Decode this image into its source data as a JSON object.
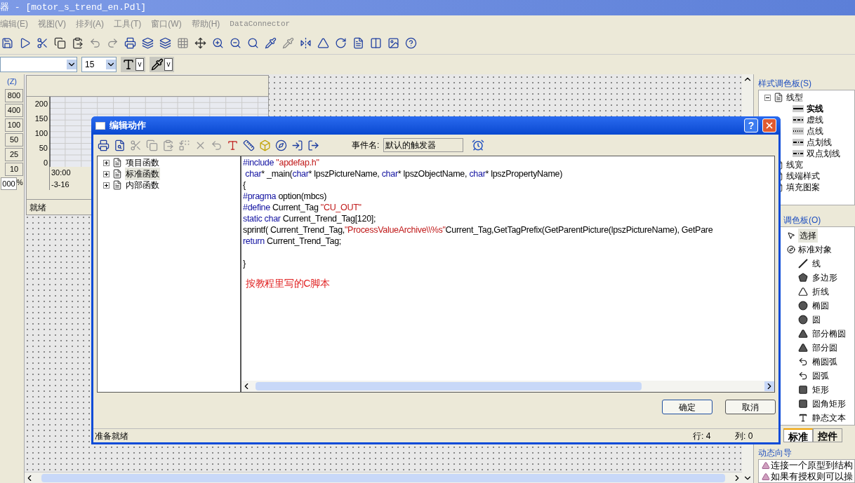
{
  "window": {
    "title": "器 - [motor_s_trend_en.Pdl]"
  },
  "menu": [
    "编辑(E)",
    "视图(V)",
    "排列(A)",
    "工具(T)",
    "窗口(W)",
    "帮助(H)",
    "DataConnector"
  ],
  "format_bar": {
    "font_size": "15",
    "carets": [
      "v",
      "v"
    ]
  },
  "zoom_panel": {
    "title": "(Z)",
    "buttons": [
      "800",
      "400",
      "100",
      "50",
      "25",
      "10"
    ],
    "field": "000",
    "unit": "%"
  },
  "trend_window": {
    "yticks": [
      "200",
      "150",
      "100",
      "50",
      "0"
    ],
    "time": "30:00",
    "date": "-3-16",
    "status": "就绪"
  },
  "style_palette": {
    "title": "样式调色板(S)",
    "items": [
      {
        "label": "线型",
        "expanded": true,
        "children": [
          {
            "label": "实线",
            "selected": true
          },
          {
            "label": "虚线",
            "selected": false
          },
          {
            "label": "点线",
            "selected": false
          },
          {
            "label": "点划线",
            "selected": false
          },
          {
            "label": "双点划线",
            "selected": false
          }
        ]
      },
      {
        "label": "线宽",
        "expanded": false
      },
      {
        "label": "线端样式",
        "expanded": false
      },
      {
        "label": "填充图案",
        "expanded": false
      }
    ]
  },
  "object_palette": {
    "title": "调色板(O)",
    "select": {
      "label": "选择",
      "selected": true
    },
    "group": "标准对象",
    "items": [
      "线",
      "多边形",
      "折线",
      "椭圆",
      "圆",
      "部分椭圆",
      "部分圆",
      "椭圆弧",
      "圆弧",
      "矩形",
      "圆角矩形",
      "静态文本"
    ],
    "tabs": [
      {
        "label": "标准",
        "selected": true
      },
      {
        "label": "控件",
        "selected": false
      }
    ]
  },
  "dynamic_wizard": {
    "title": "动态向导",
    "items": [
      "连接一个原型到结构",
      "如果有授权则可以操"
    ]
  },
  "dialog": {
    "title": "编辑动作",
    "help": "?",
    "event_label": "事件名:",
    "event_value": "默认的触发器",
    "tree": [
      {
        "label": "项目函数",
        "expanded": false,
        "selected": false
      },
      {
        "label": "标准函数",
        "expanded": false,
        "selected": true
      },
      {
        "label": "内部函数",
        "expanded": false,
        "selected": false
      }
    ],
    "code": [
      {
        "kind": "code",
        "segments": [
          {
            "kind": "keyword",
            "text": "#include"
          },
          {
            "kind": "string",
            "text": " \"apdefap.h\""
          }
        ]
      },
      {
        "kind": "code",
        "segments": [
          {
            "kind": "keyword",
            "text": " char"
          },
          {
            "kind": "plain",
            "text": "* _main("
          },
          {
            "kind": "keyword",
            "text": "char"
          },
          {
            "kind": "plain",
            "text": "* lpszPictureName, "
          },
          {
            "kind": "keyword",
            "text": "char"
          },
          {
            "kind": "plain",
            "text": "* lpszObjectName, "
          },
          {
            "kind": "keyword",
            "text": "char"
          },
          {
            "kind": "plain",
            "text": "* lpszPropertyName)"
          }
        ]
      },
      {
        "kind": "code",
        "segments": [
          {
            "kind": "plain",
            "text": "{"
          }
        ]
      },
      {
        "kind": "code",
        "segments": [
          {
            "kind": "keyword",
            "text": "#pragma"
          },
          {
            "kind": "plain",
            "text": " option(mbcs)"
          }
        ]
      },
      {
        "kind": "code",
        "segments": [
          {
            "kind": "keyword",
            "text": "#define"
          },
          {
            "kind": "plain",
            "text": " Current_Tag "
          },
          {
            "kind": "string",
            "text": "\"CU_OUT\""
          }
        ]
      },
      {
        "kind": "code",
        "segments": [
          {
            "kind": "keyword",
            "text": "static char"
          },
          {
            "kind": "plain",
            "text": " Current_Trend_Tag[120];"
          }
        ]
      },
      {
        "kind": "code",
        "segments": [
          {
            "kind": "plain",
            "text": "sprintf( Current_Trend_Tag,"
          },
          {
            "kind": "string",
            "text": "\"ProcessValueArchive\\\\%s\""
          },
          {
            "kind": "plain",
            "text": "Current_Tag,GetTagPrefix(GetParentPicture(lpszPictureName), GetPare"
          }
        ]
      },
      {
        "kind": "code",
        "segments": [
          {
            "kind": "keyword",
            "text": "return"
          },
          {
            "kind": "plain",
            "text": " Current_Trend_Tag;"
          }
        ]
      },
      {
        "kind": "blank"
      },
      {
        "kind": "code",
        "segments": [
          {
            "kind": "plain",
            "text": "}"
          }
        ]
      }
    ],
    "note": "按教程里写的C脚本",
    "buttons": [
      "确定",
      "取消"
    ],
    "status": "准备就绪",
    "line": "行: 4",
    "column": "列: 0"
  }
}
